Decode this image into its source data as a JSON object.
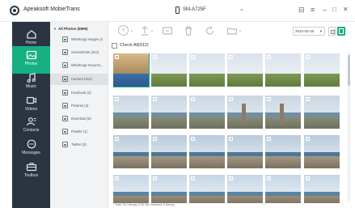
{
  "app": {
    "title": "Apeaksoft MobieTrans"
  },
  "device": {
    "name": "SM-A725F"
  },
  "window_controls": [
    "⊟",
    "≡",
    "–",
    "□",
    "✕"
  ],
  "sidebar": {
    "items": [
      {
        "label": "Home",
        "icon": "home-icon",
        "active": false
      },
      {
        "label": "Photos",
        "icon": "photos-icon",
        "active": true
      },
      {
        "label": "Music",
        "icon": "music-icon",
        "active": false
      },
      {
        "label": "Videos",
        "icon": "videos-icon",
        "active": false
      },
      {
        "label": "Contacts",
        "icon": "contacts-icon",
        "active": false
      },
      {
        "label": "Messages",
        "icon": "messages-icon",
        "active": false
      },
      {
        "label": "Toolbox",
        "icon": "toolbox-icon",
        "active": false
      }
    ]
  },
  "albums": {
    "header": "All Photos (5895)",
    "items": [
      {
        "label": "WhatsApp Images (4",
        "active": false
      },
      {
        "label": "Screenshots (314)",
        "active": false
      },
      {
        "label": "WhatsApp Docume...",
        "active": false
      },
      {
        "label": "Camera (912)",
        "active": true
      },
      {
        "label": "Facebook (2)",
        "active": false
      },
      {
        "label": "Pictures (4)",
        "active": false
      },
      {
        "label": "Download (6)",
        "active": false
      },
      {
        "label": "Pixeller (1)",
        "active": false
      },
      {
        "label": "Twitter (3)",
        "active": false
      }
    ]
  },
  "toolbar": {
    "buttons": [
      "add-icon",
      "export-icon",
      "import-icon",
      "delete-icon",
      "refresh-icon",
      "folder-icon"
    ],
    "date_value": "2022-03-16"
  },
  "check_all": {
    "label": "Check All(912)"
  },
  "status": {
    "text": "Total: 912 Item(s) 5.38 GB; Checked: 0 Item(s)"
  },
  "colors": {
    "accent": "#16b082",
    "sidebar": "#2b3542"
  }
}
